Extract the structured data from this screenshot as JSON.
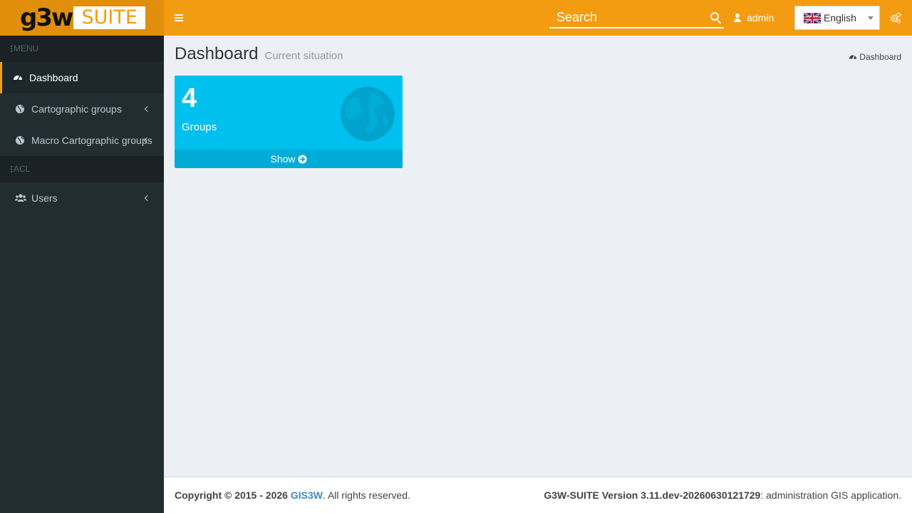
{
  "header": {
    "logo_text_left": "g3w",
    "logo_text_right": "SUITE",
    "search_placeholder": "Search",
    "username": "admin",
    "language": "English"
  },
  "sidebar": {
    "sections": [
      {
        "title": "MENU",
        "items": [
          {
            "label": "Dashboard",
            "icon": "dashboard-icon",
            "active": true
          },
          {
            "label": "Cartographic groups",
            "icon": "globe-icon"
          },
          {
            "label": "Macro Cartographic groups",
            "icon": "globe-icon"
          }
        ]
      },
      {
        "title": "ACL",
        "items": [
          {
            "label": "Users",
            "icon": "users-icon"
          }
        ]
      }
    ]
  },
  "content": {
    "title": "Dashboard",
    "subtitle": "Current situation",
    "breadcrumb": "Dashboard",
    "box": {
      "count": "4",
      "label": "Groups",
      "footer": "Show",
      "color": "#00c0ef"
    }
  },
  "footer": {
    "copyright_prefix": "Copyright © 2015 - 2026 ",
    "company": "GIS3W",
    "rights": ". All rights reserved.",
    "version": "G3W-SUITE Version 3.11.dev-20260630121729",
    "description": ": administration GIS application."
  },
  "colors": {
    "accent": "#f39c12",
    "sidebar_bg": "#222d32",
    "content_bg": "#ecf0f5",
    "info_box": "#00c0ef",
    "link": "#3c8dbc"
  }
}
